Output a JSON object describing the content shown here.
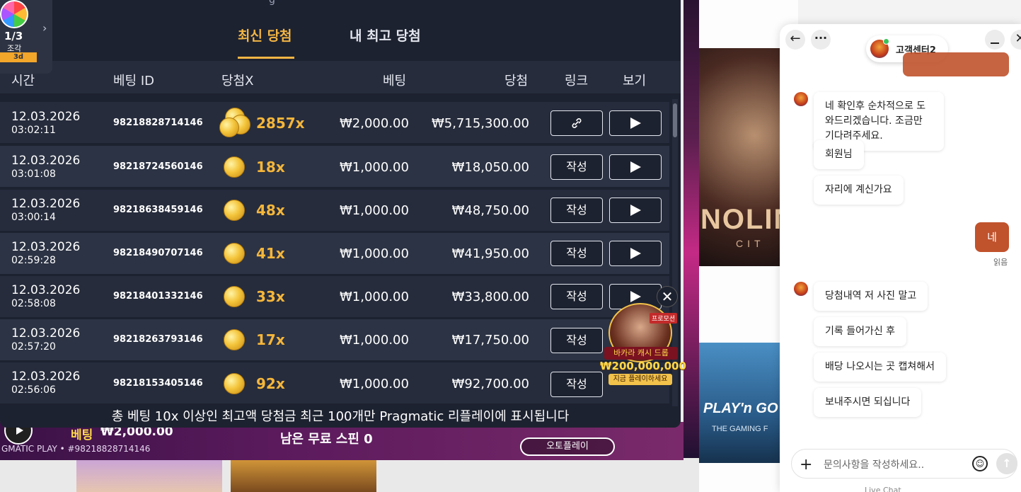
{
  "modal": {
    "top_title_fragment": "g",
    "tabs": [
      {
        "label": "최신 당첨",
        "active": true
      },
      {
        "label": "내 최고 당첨",
        "active": false
      }
    ],
    "columns": [
      "시간",
      "베팅 ID",
      "당첨X",
      "베팅",
      "당첨",
      "링크",
      "보기"
    ],
    "rows": [
      {
        "date": "12.03.2026",
        "time": "03:02:11",
        "bet_id": "98218828714146",
        "multiplier": "2857x",
        "bet": "₩2,000.00",
        "win": "₩5,715,300.00",
        "link": "link-icon"
      },
      {
        "date": "12.03.2026",
        "time": "03:01:08",
        "bet_id": "98218724560146",
        "multiplier": "18x",
        "bet": "₩1,000.00",
        "win": "₩18,050.00",
        "link": "작성"
      },
      {
        "date": "12.03.2026",
        "time": "03:00:14",
        "bet_id": "98218638459146",
        "multiplier": "48x",
        "bet": "₩1,000.00",
        "win": "₩48,750.00",
        "link": "작성"
      },
      {
        "date": "12.03.2026",
        "time": "02:59:28",
        "bet_id": "98218490707146",
        "multiplier": "41x",
        "bet": "₩1,000.00",
        "win": "₩41,950.00",
        "link": "작성"
      },
      {
        "date": "12.03.2026",
        "time": "02:58:08",
        "bet_id": "98218401332146",
        "multiplier": "33x",
        "bet": "₩1,000.00",
        "win": "₩33,800.00",
        "link": "작성"
      },
      {
        "date": "12.03.2026",
        "time": "02:57:20",
        "bet_id": "98218263793146",
        "multiplier": "17x",
        "bet": "₩1,000.00",
        "win": "₩17,750.00",
        "link": "작성"
      },
      {
        "date": "12.03.2026",
        "time": "02:56:06",
        "bet_id": "98218153405146",
        "multiplier": "92x",
        "bet": "₩1,000.00",
        "win": "₩92,700.00",
        "link": "작성"
      }
    ],
    "footer_note": "총 베팅 10x 이상인 최고액 당첨금 최근 100개만 Pragmatic 리플레이에 표시됩니다"
  },
  "spin_badge": {
    "count": "1/3",
    "piece": "조각",
    "time": "3d"
  },
  "game": {
    "bet_label": "베팅",
    "bet_value": "₩2,000.00",
    "game_id": "GMATIC PLAY • #98218828714146",
    "free_spins": "남은 무료 스핀 0",
    "auto_play": "오토플레이"
  },
  "promo": {
    "tag": "프로모션",
    "title": "바카라 캐시 드롭",
    "amount": "₩200,000,000",
    "cta": "지금 플레이하세요"
  },
  "background": {
    "art1_text": "NOLIN",
    "art1_sub": "CIT",
    "art2_text": "PLAY'n GO",
    "art2_sub": "THE GAMING F"
  },
  "chat": {
    "title": "고객센터2",
    "messages_in": [
      "네 확인후 순차적으로 도와드리겠습니다. 조금만 기다려주세요.",
      "회원님",
      "자리에 계신가요",
      "당첨내역 저 사진 말고",
      "기록 들어가신 후",
      "배당 나오시는 곳 캡쳐해서",
      "보내주시면 되십니다"
    ],
    "message_out": "네",
    "read_label": "읽음",
    "input_placeholder": "문의사항을 작성하세요..",
    "brand": "Live Chat"
  },
  "colors": {
    "accent_tab": "#f2b544",
    "multiplier": "#f5b63a",
    "chat_out_bubble": "#c0522c",
    "modal_bg": "#1d2230"
  }
}
